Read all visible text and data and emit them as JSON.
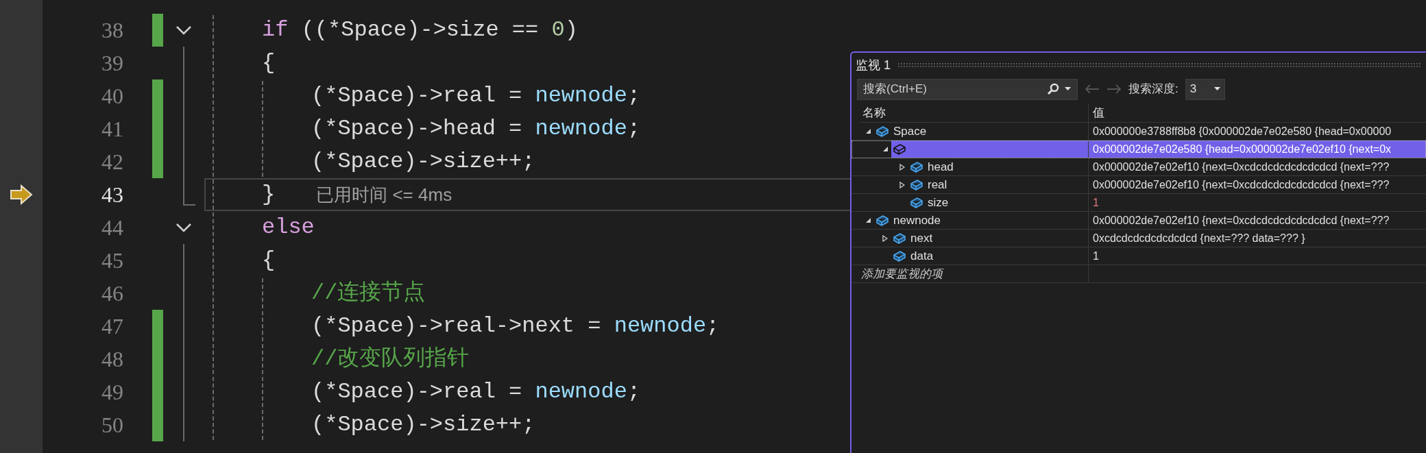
{
  "editor": {
    "lines": [
      {
        "number": "38",
        "changed": true,
        "fold_start": true,
        "fold_end": false,
        "current": false,
        "indented": false,
        "tokens": [
          {
            "kind": "keyword",
            "text": "if"
          },
          {
            "kind": "plain",
            "text": " ((*Space)->size == "
          },
          {
            "kind": "number",
            "text": "0"
          },
          {
            "kind": "plain",
            "text": ")"
          }
        ]
      },
      {
        "number": "39",
        "changed": false,
        "fold_start": false,
        "fold_end": false,
        "current": false,
        "indented": false,
        "tokens": [
          {
            "kind": "plain",
            "text": "{"
          }
        ]
      },
      {
        "number": "40",
        "changed": true,
        "fold_start": false,
        "fold_end": false,
        "current": false,
        "indented": true,
        "tokens": [
          {
            "kind": "plain",
            "text": "(*Space)->real = "
          },
          {
            "kind": "variable",
            "text": "newnode"
          },
          {
            "kind": "plain",
            "text": ";"
          }
        ]
      },
      {
        "number": "41",
        "changed": true,
        "fold_start": false,
        "fold_end": false,
        "current": false,
        "indented": true,
        "tokens": [
          {
            "kind": "plain",
            "text": "(*Space)->head = "
          },
          {
            "kind": "variable",
            "text": "newnode"
          },
          {
            "kind": "plain",
            "text": ";"
          }
        ]
      },
      {
        "number": "42",
        "changed": true,
        "fold_start": false,
        "fold_end": false,
        "current": false,
        "indented": true,
        "tokens": [
          {
            "kind": "plain",
            "text": "(*Space)->size++;"
          }
        ]
      },
      {
        "number": "43",
        "changed": false,
        "fold_start": false,
        "fold_end": true,
        "current": true,
        "indented": false,
        "tokens": [
          {
            "kind": "plain",
            "text": "}"
          }
        ],
        "hint": "已用时间 <= 4ms"
      },
      {
        "number": "44",
        "changed": false,
        "fold_start": true,
        "fold_end": false,
        "current": false,
        "indented": false,
        "tokens": [
          {
            "kind": "keyword",
            "text": "else"
          }
        ]
      },
      {
        "number": "45",
        "changed": false,
        "fold_start": false,
        "fold_end": false,
        "current": false,
        "indented": false,
        "tokens": [
          {
            "kind": "plain",
            "text": "{"
          }
        ]
      },
      {
        "number": "46",
        "changed": false,
        "fold_start": false,
        "fold_end": false,
        "current": false,
        "indented": true,
        "tokens": [
          {
            "kind": "comment",
            "text": "//连接节点"
          }
        ]
      },
      {
        "number": "47",
        "changed": true,
        "fold_start": false,
        "fold_end": false,
        "current": false,
        "indented": true,
        "tokens": [
          {
            "kind": "plain",
            "text": "(*Space)->real->next = "
          },
          {
            "kind": "variable",
            "text": "newnode"
          },
          {
            "kind": "plain",
            "text": ";"
          }
        ]
      },
      {
        "number": "48",
        "changed": true,
        "fold_start": false,
        "fold_end": false,
        "current": false,
        "indented": true,
        "tokens": [
          {
            "kind": "comment",
            "text": "//改变队列指针"
          }
        ]
      },
      {
        "number": "49",
        "changed": true,
        "fold_start": false,
        "fold_end": false,
        "current": false,
        "indented": true,
        "tokens": [
          {
            "kind": "plain",
            "text": "(*Space)->real = "
          },
          {
            "kind": "variable",
            "text": "newnode"
          },
          {
            "kind": "plain",
            "text": ";"
          }
        ]
      },
      {
        "number": "50",
        "changed": true,
        "fold_start": false,
        "fold_end": false,
        "current": false,
        "indented": true,
        "tokens": [
          {
            "kind": "plain",
            "text": "(*Space)->size++;"
          }
        ]
      }
    ]
  },
  "watch": {
    "title": "监视 1",
    "search": {
      "placeholder": "搜索(Ctrl+E)"
    },
    "depth_label": "搜索深度:",
    "depth": "3",
    "columns": [
      "名称",
      "值"
    ],
    "rows": [
      {
        "name": "Space",
        "value": "0x000000e3788ff8b8 {0x000002de7e02e580 {head=0x00000",
        "expanded": true,
        "selected": false,
        "changed": false,
        "children": [
          {
            "value": "0x000002de7e02e580 {head=0x000002de7e02ef10 {next=0x",
            "expanded": true,
            "selected": true,
            "changed": false,
            "children": [
              {
                "name": "head",
                "value": "0x000002de7e02ef10 {next=0xcdcdcdcdcdcdcdcd {next=???",
                "expanded": false,
                "selected": false,
                "changed": false
              },
              {
                "name": "real",
                "value": "0x000002de7e02ef10 {next=0xcdcdcdcdcdcdcdcd {next=???",
                "expanded": false,
                "selected": false,
                "changed": false
              },
              {
                "name": "size",
                "value": "1",
                "selected": false,
                "changed": true
              }
            ]
          }
        ]
      },
      {
        "name": "newnode",
        "value": "0x000002de7e02ef10 {next=0xcdcdcdcdcdcdcdcd {next=???",
        "expanded": true,
        "selected": false,
        "changed": false,
        "children": [
          {
            "name": "next",
            "value": "0xcdcdcdcdcdcdcdcd {next=??? data=??? }",
            "expanded": false,
            "selected": false,
            "changed": false
          },
          {
            "name": "data",
            "value": "1",
            "selected": false,
            "changed": false
          }
        ]
      }
    ],
    "add_placeholder": "添加要监视的项"
  }
}
